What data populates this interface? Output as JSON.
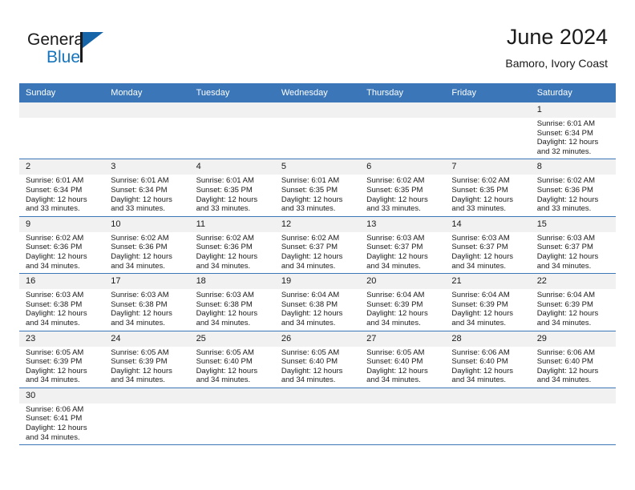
{
  "brand": {
    "name_top": "General",
    "name_bottom": "Blue",
    "triangle_icon": "triangle-icon",
    "accent_color": "#1574bb"
  },
  "header": {
    "title": "June 2024",
    "subtitle": "Bamoro, Ivory Coast"
  },
  "calendar": {
    "header_bg": "#3a76b8",
    "daynum_bg": "#f1f1f1",
    "weekdays": [
      "Sunday",
      "Monday",
      "Tuesday",
      "Wednesday",
      "Thursday",
      "Friday",
      "Saturday"
    ],
    "weeks": [
      [
        {
          "day": "",
          "lines": []
        },
        {
          "day": "",
          "lines": []
        },
        {
          "day": "",
          "lines": []
        },
        {
          "day": "",
          "lines": []
        },
        {
          "day": "",
          "lines": []
        },
        {
          "day": "",
          "lines": []
        },
        {
          "day": "1",
          "lines": [
            "Sunrise: 6:01 AM",
            "Sunset: 6:34 PM",
            "Daylight: 12 hours and 32 minutes."
          ]
        }
      ],
      [
        {
          "day": "2",
          "lines": [
            "Sunrise: 6:01 AM",
            "Sunset: 6:34 PM",
            "Daylight: 12 hours and 33 minutes."
          ]
        },
        {
          "day": "3",
          "lines": [
            "Sunrise: 6:01 AM",
            "Sunset: 6:34 PM",
            "Daylight: 12 hours and 33 minutes."
          ]
        },
        {
          "day": "4",
          "lines": [
            "Sunrise: 6:01 AM",
            "Sunset: 6:35 PM",
            "Daylight: 12 hours and 33 minutes."
          ]
        },
        {
          "day": "5",
          "lines": [
            "Sunrise: 6:01 AM",
            "Sunset: 6:35 PM",
            "Daylight: 12 hours and 33 minutes."
          ]
        },
        {
          "day": "6",
          "lines": [
            "Sunrise: 6:02 AM",
            "Sunset: 6:35 PM",
            "Daylight: 12 hours and 33 minutes."
          ]
        },
        {
          "day": "7",
          "lines": [
            "Sunrise: 6:02 AM",
            "Sunset: 6:35 PM",
            "Daylight: 12 hours and 33 minutes."
          ]
        },
        {
          "day": "8",
          "lines": [
            "Sunrise: 6:02 AM",
            "Sunset: 6:36 PM",
            "Daylight: 12 hours and 33 minutes."
          ]
        }
      ],
      [
        {
          "day": "9",
          "lines": [
            "Sunrise: 6:02 AM",
            "Sunset: 6:36 PM",
            "Daylight: 12 hours and 34 minutes."
          ]
        },
        {
          "day": "10",
          "lines": [
            "Sunrise: 6:02 AM",
            "Sunset: 6:36 PM",
            "Daylight: 12 hours and 34 minutes."
          ]
        },
        {
          "day": "11",
          "lines": [
            "Sunrise: 6:02 AM",
            "Sunset: 6:36 PM",
            "Daylight: 12 hours and 34 minutes."
          ]
        },
        {
          "day": "12",
          "lines": [
            "Sunrise: 6:02 AM",
            "Sunset: 6:37 PM",
            "Daylight: 12 hours and 34 minutes."
          ]
        },
        {
          "day": "13",
          "lines": [
            "Sunrise: 6:03 AM",
            "Sunset: 6:37 PM",
            "Daylight: 12 hours and 34 minutes."
          ]
        },
        {
          "day": "14",
          "lines": [
            "Sunrise: 6:03 AM",
            "Sunset: 6:37 PM",
            "Daylight: 12 hours and 34 minutes."
          ]
        },
        {
          "day": "15",
          "lines": [
            "Sunrise: 6:03 AM",
            "Sunset: 6:37 PM",
            "Daylight: 12 hours and 34 minutes."
          ]
        }
      ],
      [
        {
          "day": "16",
          "lines": [
            "Sunrise: 6:03 AM",
            "Sunset: 6:38 PM",
            "Daylight: 12 hours and 34 minutes."
          ]
        },
        {
          "day": "17",
          "lines": [
            "Sunrise: 6:03 AM",
            "Sunset: 6:38 PM",
            "Daylight: 12 hours and 34 minutes."
          ]
        },
        {
          "day": "18",
          "lines": [
            "Sunrise: 6:03 AM",
            "Sunset: 6:38 PM",
            "Daylight: 12 hours and 34 minutes."
          ]
        },
        {
          "day": "19",
          "lines": [
            "Sunrise: 6:04 AM",
            "Sunset: 6:38 PM",
            "Daylight: 12 hours and 34 minutes."
          ]
        },
        {
          "day": "20",
          "lines": [
            "Sunrise: 6:04 AM",
            "Sunset: 6:39 PM",
            "Daylight: 12 hours and 34 minutes."
          ]
        },
        {
          "day": "21",
          "lines": [
            "Sunrise: 6:04 AM",
            "Sunset: 6:39 PM",
            "Daylight: 12 hours and 34 minutes."
          ]
        },
        {
          "day": "22",
          "lines": [
            "Sunrise: 6:04 AM",
            "Sunset: 6:39 PM",
            "Daylight: 12 hours and 34 minutes."
          ]
        }
      ],
      [
        {
          "day": "23",
          "lines": [
            "Sunrise: 6:05 AM",
            "Sunset: 6:39 PM",
            "Daylight: 12 hours and 34 minutes."
          ]
        },
        {
          "day": "24",
          "lines": [
            "Sunrise: 6:05 AM",
            "Sunset: 6:39 PM",
            "Daylight: 12 hours and 34 minutes."
          ]
        },
        {
          "day": "25",
          "lines": [
            "Sunrise: 6:05 AM",
            "Sunset: 6:40 PM",
            "Daylight: 12 hours and 34 minutes."
          ]
        },
        {
          "day": "26",
          "lines": [
            "Sunrise: 6:05 AM",
            "Sunset: 6:40 PM",
            "Daylight: 12 hours and 34 minutes."
          ]
        },
        {
          "day": "27",
          "lines": [
            "Sunrise: 6:05 AM",
            "Sunset: 6:40 PM",
            "Daylight: 12 hours and 34 minutes."
          ]
        },
        {
          "day": "28",
          "lines": [
            "Sunrise: 6:06 AM",
            "Sunset: 6:40 PM",
            "Daylight: 12 hours and 34 minutes."
          ]
        },
        {
          "day": "29",
          "lines": [
            "Sunrise: 6:06 AM",
            "Sunset: 6:40 PM",
            "Daylight: 12 hours and 34 minutes."
          ]
        }
      ],
      [
        {
          "day": "30",
          "lines": [
            "Sunrise: 6:06 AM",
            "Sunset: 6:41 PM",
            "Daylight: 12 hours and 34 minutes."
          ]
        },
        {
          "day": "",
          "lines": []
        },
        {
          "day": "",
          "lines": []
        },
        {
          "day": "",
          "lines": []
        },
        {
          "day": "",
          "lines": []
        },
        {
          "day": "",
          "lines": []
        },
        {
          "day": "",
          "lines": []
        }
      ]
    ]
  }
}
